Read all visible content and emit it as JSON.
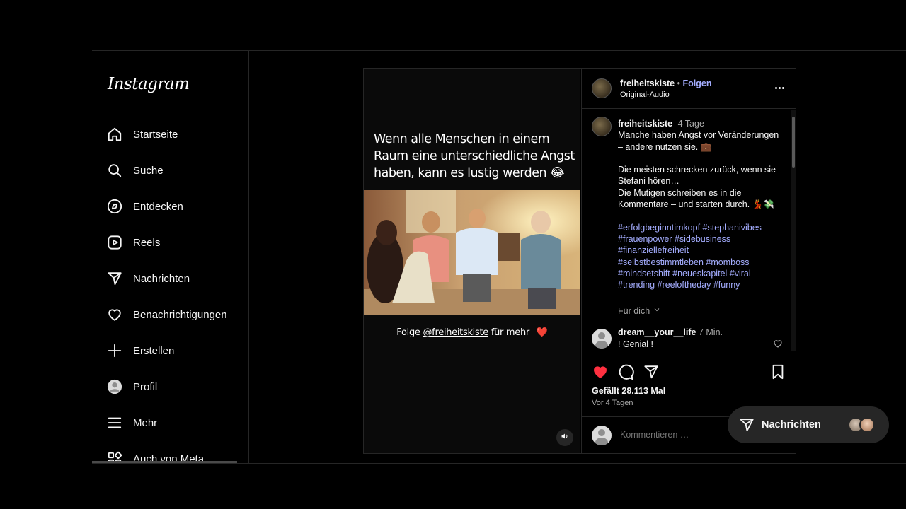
{
  "app": {
    "logo": "Instagram"
  },
  "sidebar": {
    "items": [
      {
        "label": "Startseite",
        "icon": "home-icon"
      },
      {
        "label": "Suche",
        "icon": "search-icon"
      },
      {
        "label": "Entdecken",
        "icon": "compass-icon"
      },
      {
        "label": "Reels",
        "icon": "reels-icon"
      },
      {
        "label": "Nachrichten",
        "icon": "send-icon"
      },
      {
        "label": "Benachrichtigungen",
        "icon": "heart-icon"
      },
      {
        "label": "Erstellen",
        "icon": "plus-icon"
      },
      {
        "label": "Profil",
        "icon": "avatar-icon"
      },
      {
        "label": "Mehr",
        "icon": "menu-icon"
      },
      {
        "label": "Auch von Meta",
        "icon": "meta-apps-icon"
      }
    ]
  },
  "post": {
    "video": {
      "overlay_text": "Wenn alle Menschen in einem Raum eine unterschiedliche Angst haben, kann es lustig werden 😂",
      "caption_prefix": "Folge",
      "caption_mention": "@freiheitskiste",
      "caption_suffix": "für mehr",
      "caption_emoji": "❤️"
    },
    "header": {
      "username": "freiheitskiste",
      "separator": "•",
      "follow_label": "Folgen",
      "audio": "Original-Audio"
    },
    "caption": {
      "username": "freiheitskiste",
      "time": "4 Tage",
      "para1": "Manche haben Angst vor Veränderungen – andere nutzen sie. 💼",
      "para2_line1": "Die meisten schrecken zurück, wenn sie Stefani hören…",
      "para2_line2": "Die Mutigen schreiben es in die Kommentare – und starten durch. 💃💸",
      "hashtags": [
        "#erfolgbeginntimkopf",
        "#stephanivibes",
        "#frauenpower",
        "#sidebusiness",
        "#finanziellefreiheit",
        "#selbstbestimmtleben",
        "#momboss",
        "#mindsetshift",
        "#neueskapitel",
        "#viral",
        "#trending",
        "#reeloftheday",
        "#funny"
      ],
      "translate_label": "Für dich"
    },
    "comment": {
      "username": "dream__your__life",
      "time": "7 Min.",
      "text": "! Genial !"
    },
    "likes": "Gefällt 28.113 Mal",
    "ago": "Vor 4 Tagen",
    "comment_placeholder": "Kommentieren …",
    "colors": {
      "like_red": "#ff3040",
      "link_blue": "#a4adff"
    }
  },
  "messages_pill": {
    "label": "Nachrichten"
  }
}
